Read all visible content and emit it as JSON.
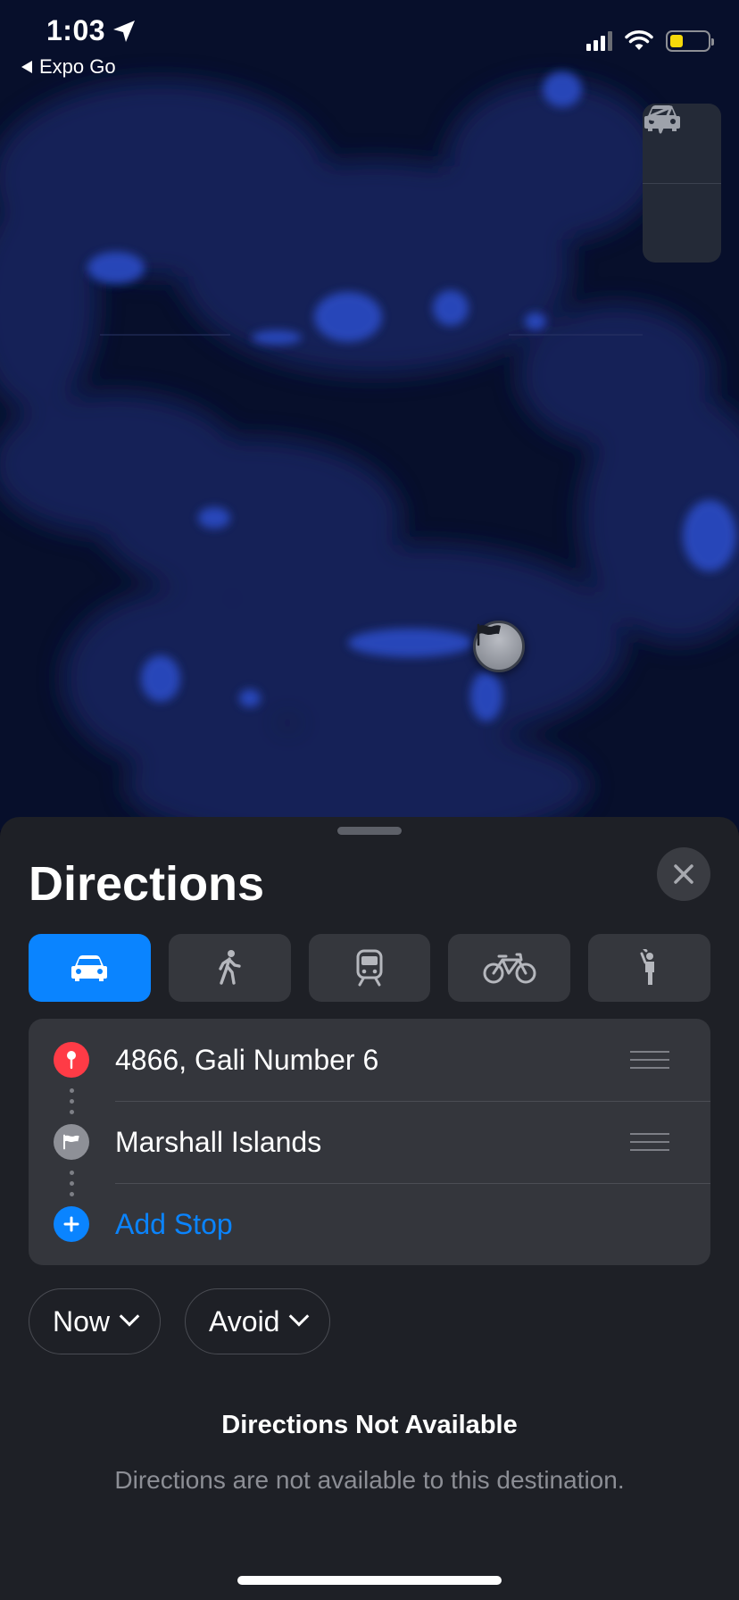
{
  "status_bar": {
    "time": "1:03",
    "back_app": "Expo Go"
  },
  "map": {
    "controls": [
      {
        "icon": "car-icon"
      },
      {
        "icon": "location-arrow-icon"
      }
    ],
    "destination_pin_icon": "flag-icon"
  },
  "sheet": {
    "title": "Directions",
    "transport_modes": [
      {
        "icon": "car-icon",
        "selected": true
      },
      {
        "icon": "walk-icon",
        "selected": false
      },
      {
        "icon": "transit-icon",
        "selected": false
      },
      {
        "icon": "bicycle-icon",
        "selected": false
      },
      {
        "icon": "rideshare-icon",
        "selected": false
      }
    ],
    "route": {
      "origin": "4866, Gali Number 6",
      "destination": "Marshall Islands",
      "add_stop": "Add Stop"
    },
    "time_option": "Now",
    "avoid_option": "Avoid",
    "message_title": "Directions Not Available",
    "message_body": "Directions are not available to this destination."
  },
  "colors": {
    "accent": "#0a84ff",
    "origin_pin": "#ff3b46",
    "battery": "#f5d90a"
  }
}
